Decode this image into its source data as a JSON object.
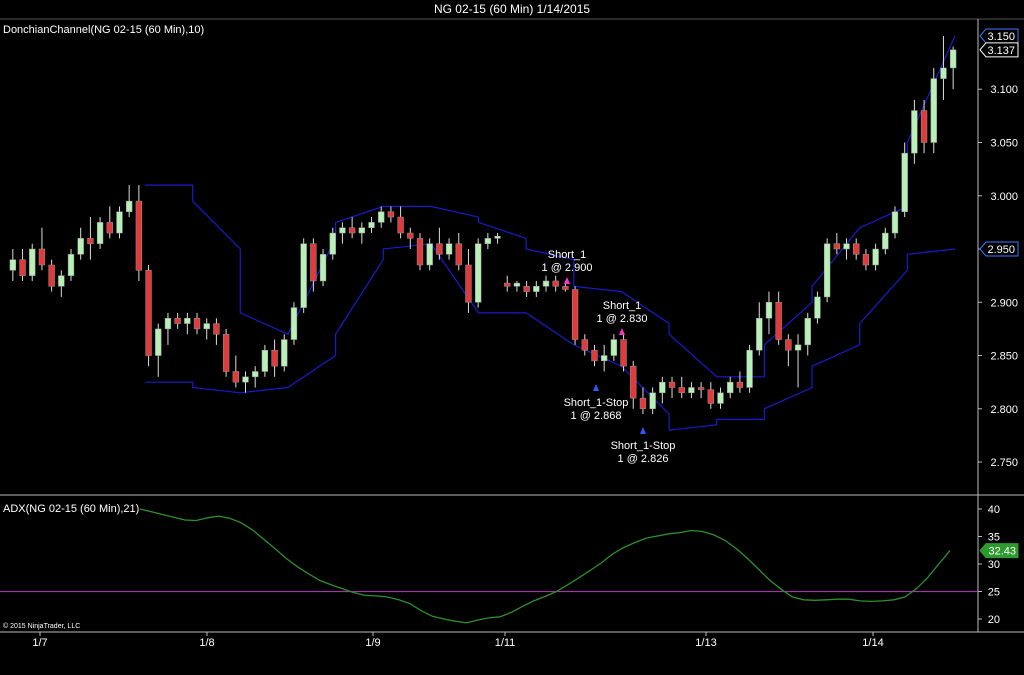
{
  "window_title": "NG 02-15 (60 Min)  1/14/2015",
  "copyright": "© 2015 NinjaTrader, LLC",
  "colors": {
    "background": "#000000",
    "up_candle": "#b8f0b8",
    "down_candle": "#e03a3a",
    "donchian": "#1a1acc",
    "adx_line": "#2f8f2f",
    "adx_threshold": "#9a3aa0",
    "buy_marker": "#ff33cc",
    "stop_marker": "#2b5bff"
  },
  "chart_data": [
    {
      "type": "candlestick",
      "indicator_label": "DonchianChannel(NG 02-15 (60 Min),10)",
      "ylim": [
        2.72,
        3.165
      ],
      "yticks": [
        "2.750",
        "2.800",
        "2.850",
        "2.900",
        "2.950",
        "3.000",
        "3.050",
        "3.100"
      ],
      "xticks": [
        "1/7",
        "1/8",
        "1/9",
        "1/11",
        "1/13",
        "1/14"
      ],
      "price_flags": [
        {
          "label": "3.150",
          "value": 3.15,
          "style": "blue"
        },
        {
          "label": "3.137",
          "value": 3.137,
          "style": "white"
        },
        {
          "label": "2.950",
          "value": 2.95,
          "style": "blue"
        }
      ],
      "ohlc": [
        [
          2.93,
          2.95,
          2.92,
          2.94
        ],
        [
          2.94,
          2.95,
          2.92,
          2.925
        ],
        [
          2.925,
          2.955,
          2.92,
          2.95
        ],
        [
          2.95,
          2.97,
          2.93,
          2.935
        ],
        [
          2.935,
          2.94,
          2.91,
          2.915
        ],
        [
          2.915,
          2.93,
          2.905,
          2.925
        ],
        [
          2.925,
          2.95,
          2.92,
          2.945
        ],
        [
          2.945,
          2.97,
          2.94,
          2.96
        ],
        [
          2.96,
          2.98,
          2.94,
          2.955
        ],
        [
          2.955,
          2.98,
          2.95,
          2.975
        ],
        [
          2.975,
          2.99,
          2.96,
          2.965
        ],
        [
          2.965,
          2.99,
          2.96,
          2.985
        ],
        [
          2.985,
          3.01,
          2.98,
          2.995
        ],
        [
          2.995,
          3.01,
          2.92,
          2.93
        ],
        [
          2.93,
          2.935,
          2.84,
          2.85
        ],
        [
          2.85,
          2.88,
          2.83,
          2.875
        ],
        [
          2.875,
          2.89,
          2.86,
          2.885
        ],
        [
          2.885,
          2.89,
          2.875,
          2.88
        ],
        [
          2.88,
          2.89,
          2.87,
          2.885
        ],
        [
          2.885,
          2.89,
          2.87,
          2.875
        ],
        [
          2.875,
          2.885,
          2.865,
          2.88
        ],
        [
          2.88,
          2.885,
          2.86,
          2.87
        ],
        [
          2.87,
          2.875,
          2.83,
          2.835
        ],
        [
          2.835,
          2.85,
          2.82,
          2.825
        ],
        [
          2.825,
          2.835,
          2.815,
          2.83
        ],
        [
          2.83,
          2.84,
          2.82,
          2.835
        ],
        [
          2.835,
          2.86,
          2.83,
          2.855
        ],
        [
          2.855,
          2.865,
          2.83,
          2.84
        ],
        [
          2.84,
          2.87,
          2.835,
          2.865
        ],
        [
          2.865,
          2.9,
          2.86,
          2.895
        ],
        [
          2.895,
          2.96,
          2.89,
          2.955
        ],
        [
          2.955,
          2.96,
          2.91,
          2.92
        ],
        [
          2.92,
          2.95,
          2.915,
          2.945
        ],
        [
          2.945,
          2.97,
          2.94,
          2.965
        ],
        [
          2.965,
          2.975,
          2.955,
          2.97
        ],
        [
          2.97,
          2.98,
          2.96,
          2.965
        ],
        [
          2.965,
          2.975,
          2.955,
          2.97
        ],
        [
          2.97,
          2.98,
          2.965,
          2.975
        ],
        [
          2.975,
          2.99,
          2.97,
          2.985
        ],
        [
          2.985,
          2.99,
          2.975,
          2.98
        ],
        [
          2.98,
          2.99,
          2.96,
          2.965
        ],
        [
          2.965,
          2.97,
          2.95,
          2.96
        ],
        [
          2.96,
          2.965,
          2.93,
          2.935
        ],
        [
          2.935,
          2.96,
          2.93,
          2.955
        ],
        [
          2.955,
          2.97,
          2.94,
          2.945
        ],
        [
          2.945,
          2.96,
          2.94,
          2.955
        ],
        [
          2.955,
          2.965,
          2.93,
          2.935
        ],
        [
          2.935,
          2.95,
          2.89,
          2.9
        ],
        [
          2.9,
          2.96,
          2.895,
          2.955
        ],
        [
          2.955,
          2.965,
          2.95,
          2.96
        ],
        [
          2.96,
          2.965,
          2.955,
          2.962
        ],
        [
          2.918,
          2.925,
          2.91,
          2.915
        ],
        [
          2.915,
          2.92,
          2.91,
          2.918
        ],
        [
          2.915,
          2.92,
          2.905,
          2.91
        ],
        [
          2.91,
          2.92,
          2.905,
          2.915
        ],
        [
          2.915,
          2.925,
          2.91,
          2.92
        ],
        [
          2.92,
          2.925,
          2.91,
          2.915
        ],
        [
          2.915,
          2.92,
          2.91,
          2.912
        ],
        [
          2.912,
          2.915,
          2.86,
          2.865
        ],
        [
          2.865,
          2.87,
          2.85,
          2.855
        ],
        [
          2.855,
          2.86,
          2.84,
          2.845
        ],
        [
          2.845,
          2.86,
          2.835,
          2.85
        ],
        [
          2.85,
          2.87,
          2.845,
          2.865
        ],
        [
          2.865,
          2.87,
          2.835,
          2.84
        ],
        [
          2.84,
          2.845,
          2.8,
          2.81
        ],
        [
          2.81,
          2.82,
          2.795,
          2.8
        ],
        [
          2.8,
          2.82,
          2.795,
          2.815
        ],
        [
          2.815,
          2.83,
          2.805,
          2.825
        ],
        [
          2.825,
          2.83,
          2.81,
          2.82
        ],
        [
          2.82,
          2.83,
          2.81,
          2.815
        ],
        [
          2.815,
          2.825,
          2.81,
          2.82
        ],
        [
          2.82,
          2.825,
          2.81,
          2.818
        ],
        [
          2.818,
          2.825,
          2.8,
          2.805
        ],
        [
          2.805,
          2.82,
          2.8,
          2.815
        ],
        [
          2.815,
          2.83,
          2.81,
          2.825
        ],
        [
          2.825,
          2.835,
          2.815,
          2.82
        ],
        [
          2.82,
          2.86,
          2.815,
          2.855
        ],
        [
          2.855,
          2.9,
          2.85,
          2.885
        ],
        [
          2.885,
          2.91,
          2.87,
          2.9
        ],
        [
          2.9,
          2.91,
          2.86,
          2.865
        ],
        [
          2.865,
          2.87,
          2.84,
          2.855
        ],
        [
          2.855,
          2.87,
          2.82,
          2.86
        ],
        [
          2.86,
          2.89,
          2.85,
          2.885
        ],
        [
          2.885,
          2.91,
          2.88,
          2.905
        ],
        [
          2.905,
          2.96,
          2.9,
          2.955
        ],
        [
          2.955,
          2.965,
          2.945,
          2.95
        ],
        [
          2.95,
          2.96,
          2.94,
          2.955
        ],
        [
          2.955,
          2.96,
          2.94,
          2.945
        ],
        [
          2.945,
          2.95,
          2.93,
          2.935
        ],
        [
          2.935,
          2.955,
          2.93,
          2.95
        ],
        [
          2.95,
          2.97,
          2.945,
          2.965
        ],
        [
          2.965,
          2.99,
          2.96,
          2.985
        ],
        [
          2.985,
          3.05,
          2.98,
          3.04
        ],
        [
          3.04,
          3.09,
          3.03,
          3.08
        ],
        [
          3.08,
          3.09,
          3.04,
          3.05
        ],
        [
          3.05,
          3.12,
          3.04,
          3.11
        ],
        [
          3.11,
          3.15,
          3.09,
          3.12
        ],
        [
          3.12,
          3.14,
          3.1,
          3.137
        ]
      ],
      "donchian_upper": [
        [
          3.01,
          3.01
        ],
        [
          2.995,
          2.95
        ],
        [
          2.89,
          2.87
        ],
        [
          2.87,
          2.96
        ],
        [
          2.975,
          2.99
        ],
        [
          2.99,
          2.99
        ],
        [
          2.99,
          2.98
        ],
        [
          2.975,
          2.96
        ],
        [
          2.95,
          2.94
        ],
        [
          2.915,
          2.91
        ],
        [
          2.91,
          2.88
        ],
        [
          2.87,
          2.83
        ],
        [
          2.83,
          2.83
        ],
        [
          2.86,
          2.9
        ],
        [
          2.915,
          2.97
        ],
        [
          2.97,
          2.99
        ],
        [
          3.05,
          3.15
        ]
      ],
      "donchian_lower": [
        [
          2.825,
          2.825
        ],
        [
          2.82,
          2.815
        ],
        [
          2.815,
          2.82
        ],
        [
          2.82,
          2.85
        ],
        [
          2.87,
          2.94
        ],
        [
          2.95,
          2.955
        ],
        [
          2.955,
          2.89
        ],
        [
          2.89,
          2.89
        ],
        [
          2.89,
          2.86
        ],
        [
          2.86,
          2.84
        ],
        [
          2.84,
          2.795
        ],
        [
          2.78,
          2.785
        ],
        [
          2.79,
          2.79
        ],
        [
          2.8,
          2.82
        ],
        [
          2.84,
          2.86
        ],
        [
          2.88,
          2.93
        ],
        [
          2.945,
          2.95
        ]
      ],
      "annotations": [
        {
          "text": "Short_1",
          "sub": "1 @ 2.900",
          "kind": "entry"
        },
        {
          "text": "Short_1",
          "sub": "1 @ 2.830",
          "kind": "entry"
        },
        {
          "text": "Short_1-Stop",
          "sub": "1 @ 2.868",
          "kind": "stop"
        },
        {
          "text": "Short_1-Stop",
          "sub": "1 @ 2.826",
          "kind": "stop"
        }
      ]
    },
    {
      "type": "line",
      "indicator_label": "ADX(NG 02-15 (60 Min),21)",
      "ylim": [
        18,
        42
      ],
      "yticks": [
        "20",
        "25",
        "30",
        "35",
        "40"
      ],
      "threshold": 25,
      "last_value_label": "32.43",
      "values": [
        40,
        39.5,
        39,
        38.5,
        38,
        37.9,
        38.4,
        38.7,
        38.3,
        37.5,
        36.2,
        34.5,
        32.8,
        31,
        29.5,
        28.2,
        27,
        26.2,
        25.5,
        24.8,
        24.3,
        24.2,
        24,
        23.5,
        22.8,
        21.5,
        20.5,
        20,
        19.6,
        19.3,
        19.8,
        20.2,
        20.4,
        21.2,
        22.3,
        23.3,
        24.1,
        25,
        26.2,
        27.5,
        28.8,
        30.2,
        31.8,
        33,
        33.9,
        34.7,
        35.1,
        35.5,
        35.7,
        36.1,
        35.9,
        35.3,
        34.3,
        32.8,
        31,
        29,
        27,
        25.4,
        24,
        23.5,
        23.4,
        23.5,
        23.6,
        23.6,
        23.3,
        23.2,
        23.3,
        23.5,
        24,
        25.5,
        27.5,
        30,
        32.43
      ]
    }
  ]
}
